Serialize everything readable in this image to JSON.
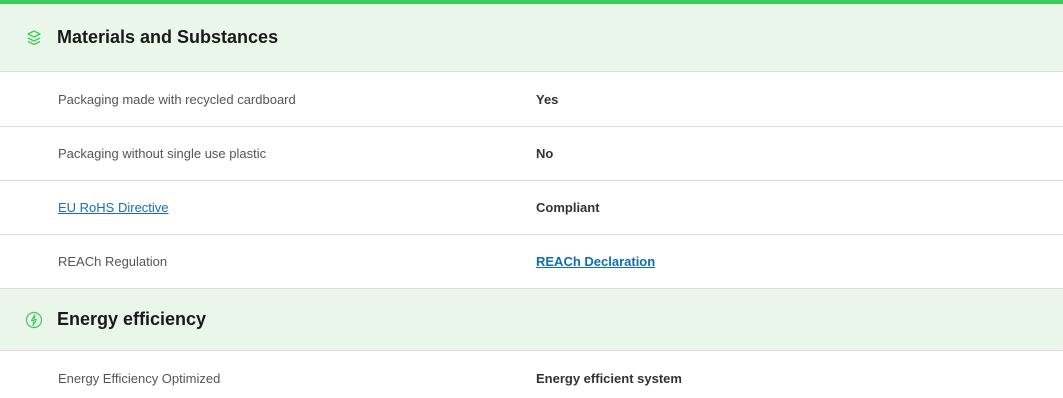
{
  "sections": [
    {
      "title": "Materials and Substances",
      "icon": "layers-icon",
      "rows": [
        {
          "label": "Packaging made with recycled cardboard",
          "value": "Yes"
        },
        {
          "label": "Packaging without single use plastic",
          "value": "No"
        },
        {
          "label": "EU RoHS Directive",
          "value": "Compliant"
        },
        {
          "label": "REACh Regulation",
          "value": "REACh Declaration"
        }
      ]
    },
    {
      "title": "Energy efficiency",
      "icon": "leaf-energy-icon",
      "rows": [
        {
          "label": "Energy Efficiency Optimized",
          "value": "Energy efficient system"
        }
      ]
    }
  ],
  "colors": {
    "accent": "#3dcd58",
    "header_bg": "#e9f6e9",
    "link": "#0f6eaf"
  }
}
